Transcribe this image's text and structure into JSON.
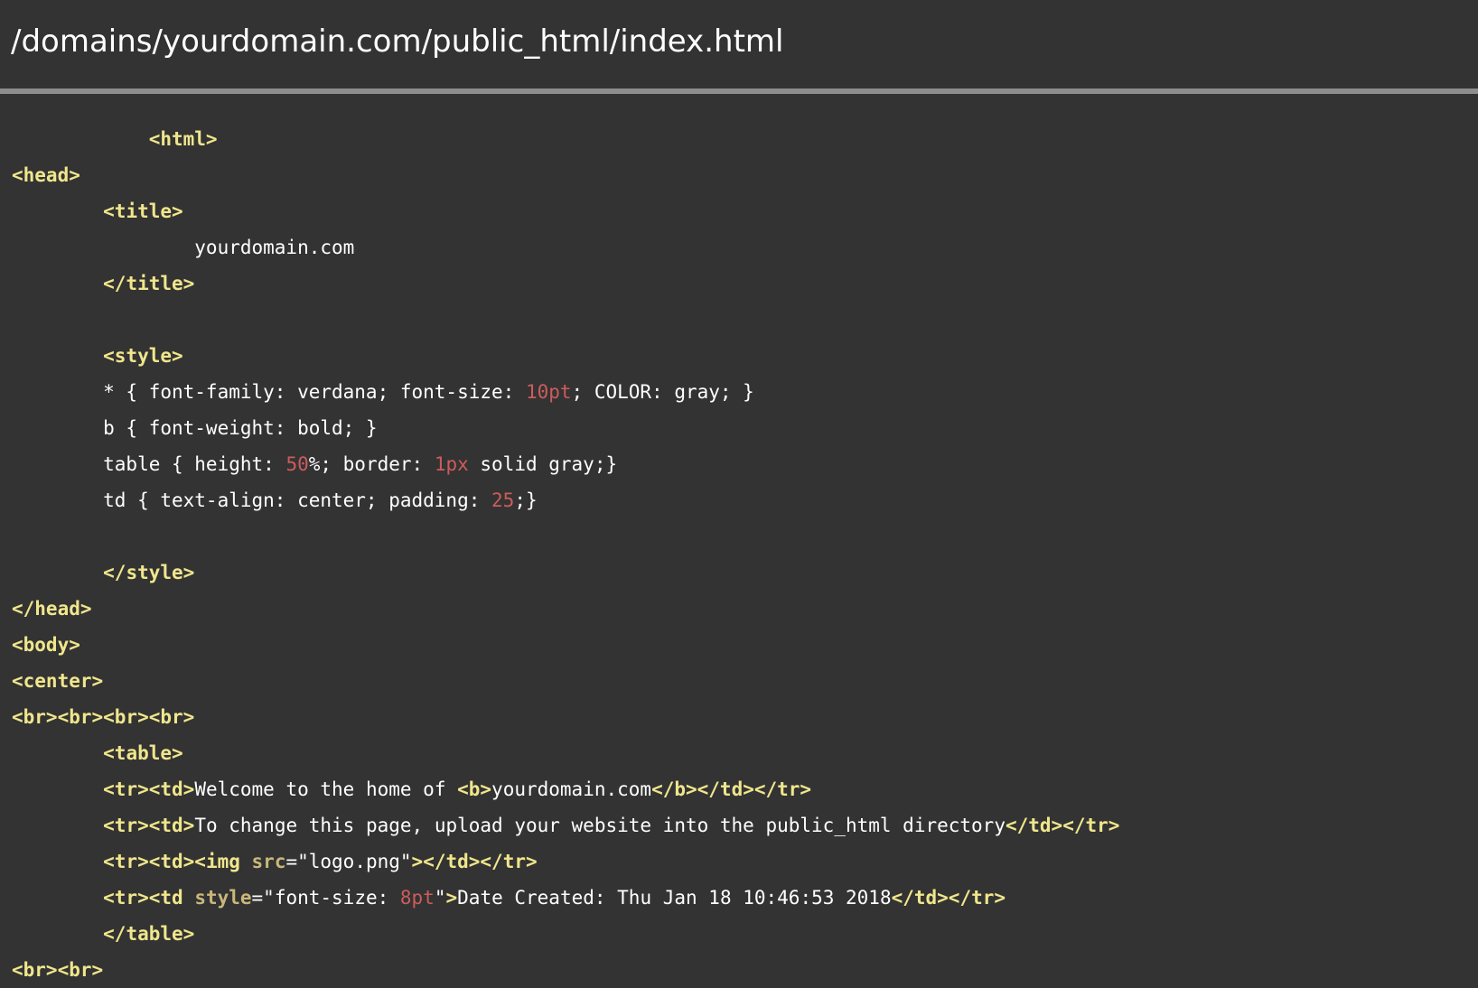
{
  "header": {
    "path": "/domains/yourdomain.com/public_html/index.html"
  },
  "colors": {
    "background": "#333333",
    "tag": "#f0e68c",
    "number": "#cd5c5c",
    "text": "#ffffff",
    "divider": "#8e8e8e"
  },
  "code": {
    "lines": [
      [
        {
          "c": "t",
          "v": "            <html>"
        }
      ],
      [
        {
          "c": "t",
          "v": "<head>"
        }
      ],
      [
        {
          "c": "s",
          "v": "        "
        },
        {
          "c": "t",
          "v": "<title>"
        }
      ],
      [
        {
          "c": "s",
          "v": "                yourdomain.com"
        }
      ],
      [
        {
          "c": "s",
          "v": "        "
        },
        {
          "c": "t",
          "v": "</title>"
        }
      ],
      [],
      [
        {
          "c": "s",
          "v": "        "
        },
        {
          "c": "t",
          "v": "<style>"
        }
      ],
      [
        {
          "c": "s",
          "v": "        * { font-family: verdana; font-size: "
        },
        {
          "c": "n",
          "v": "10pt"
        },
        {
          "c": "s",
          "v": "; COLOR: gray; }"
        }
      ],
      [
        {
          "c": "s",
          "v": "        b { font-weight: bold; }"
        }
      ],
      [
        {
          "c": "s",
          "v": "        table { height: "
        },
        {
          "c": "n",
          "v": "50"
        },
        {
          "c": "s",
          "v": "%; border: "
        },
        {
          "c": "n",
          "v": "1px"
        },
        {
          "c": "s",
          "v": " solid gray;}"
        }
      ],
      [
        {
          "c": "s",
          "v": "        td { text-align: center; padding: "
        },
        {
          "c": "n",
          "v": "25"
        },
        {
          "c": "s",
          "v": ";}"
        }
      ],
      [],
      [
        {
          "c": "s",
          "v": "        "
        },
        {
          "c": "t",
          "v": "</style>"
        }
      ],
      [
        {
          "c": "t",
          "v": "</head>"
        }
      ],
      [
        {
          "c": "t",
          "v": "<body>"
        }
      ],
      [
        {
          "c": "t",
          "v": "<center>"
        }
      ],
      [
        {
          "c": "t",
          "v": "<br><br><br><br>"
        }
      ],
      [
        {
          "c": "s",
          "v": "        "
        },
        {
          "c": "t",
          "v": "<table>"
        }
      ],
      [
        {
          "c": "s",
          "v": "        "
        },
        {
          "c": "t",
          "v": "<tr><td>"
        },
        {
          "c": "s",
          "v": "Welcome to the home of "
        },
        {
          "c": "t",
          "v": "<b>"
        },
        {
          "c": "s",
          "v": "yourdomain.com"
        },
        {
          "c": "t",
          "v": "</b></td></tr>"
        }
      ],
      [
        {
          "c": "s",
          "v": "        "
        },
        {
          "c": "t",
          "v": "<tr><td>"
        },
        {
          "c": "s",
          "v": "To change this page, upload your website into the public_html directory"
        },
        {
          "c": "t",
          "v": "</td></tr>"
        }
      ],
      [
        {
          "c": "s",
          "v": "        "
        },
        {
          "c": "t",
          "v": "<tr><td><img "
        },
        {
          "c": "a",
          "v": "src"
        },
        {
          "c": "s",
          "v": "=\"logo.png\""
        },
        {
          "c": "t",
          "v": "></td></tr>"
        }
      ],
      [
        {
          "c": "s",
          "v": "        "
        },
        {
          "c": "t",
          "v": "<tr><td "
        },
        {
          "c": "a",
          "v": "style"
        },
        {
          "c": "s",
          "v": "=\"font-size: "
        },
        {
          "c": "n",
          "v": "8pt"
        },
        {
          "c": "s",
          "v": "\""
        },
        {
          "c": "t",
          "v": ">"
        },
        {
          "c": "s",
          "v": "Date Created: Thu Jan 18 10:46:53 2018"
        },
        {
          "c": "t",
          "v": "</td></tr>"
        }
      ],
      [
        {
          "c": "s",
          "v": "        "
        },
        {
          "c": "t",
          "v": "</table>"
        }
      ],
      [
        {
          "c": "t",
          "v": "<br><br>"
        }
      ]
    ]
  }
}
